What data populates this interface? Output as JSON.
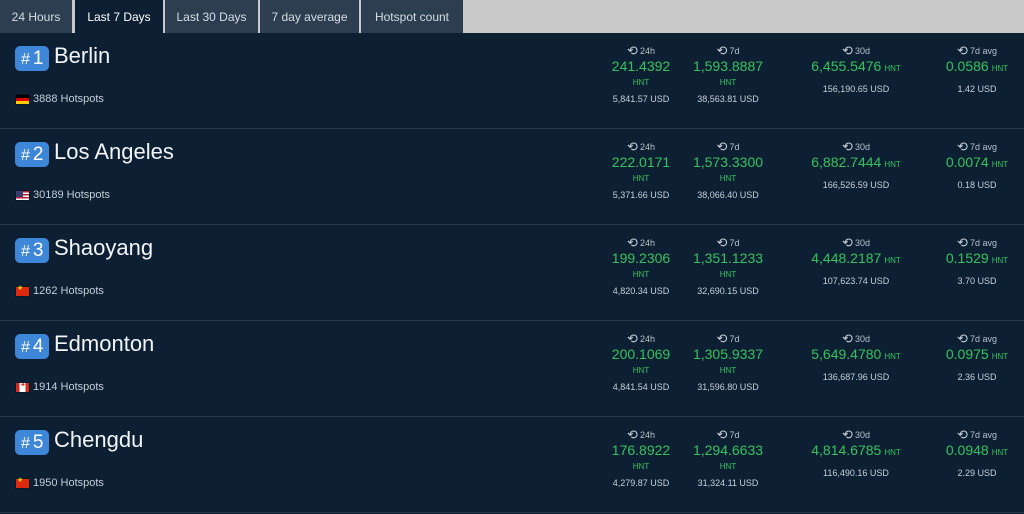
{
  "tabs": [
    {
      "label": "24 Hours",
      "active": false
    },
    {
      "label": "Last 7 Days",
      "active": true
    },
    {
      "label": "Last 30 Days",
      "active": false
    },
    {
      "label": "7 day average",
      "active": false
    },
    {
      "label": "Hotspot count",
      "active": false
    }
  ],
  "labels": {
    "hash": "#",
    "p24h": "24h",
    "p7d": "7d",
    "p30d": "30d",
    "p7davg": "7d avg",
    "unit": "HNT",
    "clock_icon": "history-icon"
  },
  "cities": [
    {
      "rank": "1",
      "name": "Berlin",
      "flag": "de",
      "hotspots": "3888 Hotspots",
      "v24h": "241.4392",
      "usd24h": "5,841.57 USD",
      "v7d": "1,593.8887",
      "usd7d": "38,563.81 USD",
      "v30d": "6,455.5476",
      "usd30d": "156,190.65 USD",
      "vavg": "0.0586",
      "usdavg": "1.42 USD"
    },
    {
      "rank": "2",
      "name": "Los Angeles",
      "flag": "us",
      "hotspots": "30189 Hotspots",
      "v24h": "222.0171",
      "usd24h": "5,371.66 USD",
      "v7d": "1,573.3300",
      "usd7d": "38,066.40 USD",
      "v30d": "6,882.7444",
      "usd30d": "166,526.59 USD",
      "vavg": "0.0074",
      "usdavg": "0.18 USD"
    },
    {
      "rank": "3",
      "name": "Shaoyang",
      "flag": "cn",
      "hotspots": "1262 Hotspots",
      "v24h": "199.2306",
      "usd24h": "4,820.34 USD",
      "v7d": "1,351.1233",
      "usd7d": "32,690.15 USD",
      "v30d": "4,448.2187",
      "usd30d": "107,623.74 USD",
      "vavg": "0.1529",
      "usdavg": "3.70 USD"
    },
    {
      "rank": "4",
      "name": "Edmonton",
      "flag": "ca",
      "hotspots": "1914 Hotspots",
      "v24h": "200.1069",
      "usd24h": "4,841.54 USD",
      "v7d": "1,305.9337",
      "usd7d": "31,596.80 USD",
      "v30d": "5,649.4780",
      "usd30d": "136,687.96 USD",
      "vavg": "0.0975",
      "usdavg": "2.36 USD"
    },
    {
      "rank": "5",
      "name": "Chengdu",
      "flag": "cn",
      "hotspots": "1950 Hotspots",
      "v24h": "176.8922",
      "usd24h": "4,279.87 USD",
      "v7d": "1,294.6633",
      "usd7d": "31,324.11 USD",
      "v30d": "4,814.6785",
      "usd30d": "116,490.16 USD",
      "vavg": "0.0948",
      "usdavg": "2.29 USD"
    }
  ]
}
